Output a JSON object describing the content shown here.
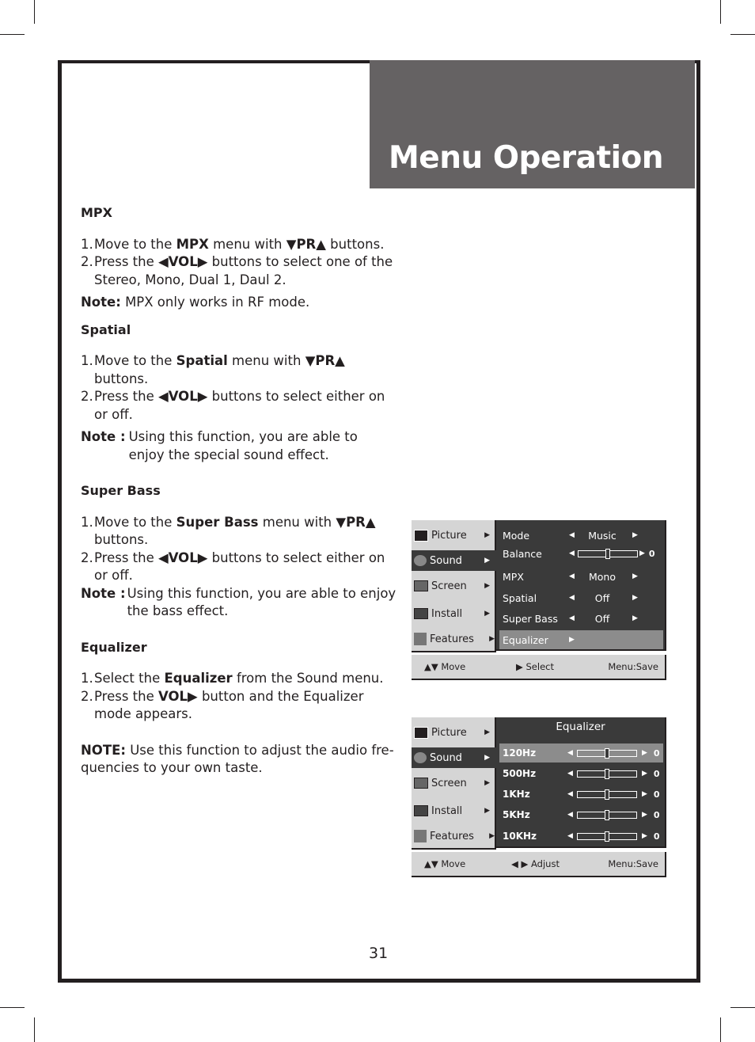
{
  "header": {
    "title": "Menu Operation"
  },
  "sections": {
    "mpx": {
      "heading": "MPX",
      "step1_num": "1.",
      "step1_a": "Move to the ",
      "step1_b": "MPX",
      "step1_c": " menu with ",
      "step1_d": "▼PR▲",
      "step1_e": " buttons.",
      "step2_num": "2.",
      "step2_a": "Press the ",
      "step2_b": "◀VOL▶",
      "step2_c": " buttons to select one of the Stereo, Mono, Dual 1, Daul 2.",
      "note_label": "Note:",
      "note_text": " MPX only works in RF mode."
    },
    "spatial": {
      "heading": "Spatial",
      "step1_num": "1.",
      "step1_a": "Move to the ",
      "step1_b": "Spatial",
      "step1_c": " menu with ",
      "step1_d": "▼PR▲",
      "step1_e": " buttons.",
      "step2_num": "2.",
      "step2_a": "Press the ",
      "step2_b": "◀VOL▶",
      "step2_c": " buttons to select either on or off.",
      "note_label": "Note :",
      "note_text": "Using this function, you are able to enjoy the special sound effect."
    },
    "superbass": {
      "heading": "Super Bass",
      "step1_num": "1.",
      "step1_a": "Move to the ",
      "step1_b": "Super Bass",
      "step1_c": " menu with ",
      "step1_d": "▼PR▲",
      "step1_e": " buttons.",
      "step2_num": "2.",
      "step2_a": "Press the ",
      "step2_b": "◀VOL▶",
      "step2_c": " buttons to select either on or off.",
      "note_label": "Note :",
      "note_text": "Using this function, you are able to enjoy the bass effect."
    },
    "equalizer": {
      "heading": "Equalizer",
      "step1_num": "1.",
      "step1_a": "Select the ",
      "step1_b": "Equalizer",
      "step1_c": " from the Sound menu.",
      "step2_num": "2.",
      "step2_a": "Press the ",
      "step2_b": "VOL▶",
      "step2_c": " button and the Equalizer mode appears.",
      "note_label": "NOTE:",
      "note_text": " Use this function to adjust the audio fre-quencies to your own taste."
    }
  },
  "osd_menu": [
    "Picture",
    "Sound",
    "Screen",
    "Install",
    "Features"
  ],
  "osd_arrow": "▶",
  "osd_left_arrow": "◀",
  "sound_menu": {
    "rows": [
      {
        "label": "Mode",
        "value": "Music"
      },
      {
        "label": "Balance",
        "slider_value": "0",
        "slider_fraction": 0.5
      },
      {
        "label": "MPX",
        "value": "Mono"
      },
      {
        "label": "Spatial",
        "value": "Off"
      },
      {
        "label": "Super Bass",
        "value": "Off"
      },
      {
        "label": "Equalizer"
      }
    ],
    "footer": {
      "move": "▲▼ Move",
      "select": "▶  Select",
      "save": "Menu:Save"
    }
  },
  "equalizer_menu": {
    "title": "Equalizer",
    "bands": [
      {
        "label": "120Hz",
        "value": "0",
        "fraction": 0.5
      },
      {
        "label": "500Hz",
        "value": "0",
        "fraction": 0.5
      },
      {
        "label": "1KHz",
        "value": "0",
        "fraction": 0.5
      },
      {
        "label": "5KHz",
        "value": "0",
        "fraction": 0.5
      },
      {
        "label": "10KHz",
        "value": "0",
        "fraction": 0.5
      }
    ],
    "footer": {
      "move": "▲▼ Move",
      "adjust": "◀ ▶ Adjust",
      "save": "Menu:Save"
    }
  },
  "page_number": "31"
}
